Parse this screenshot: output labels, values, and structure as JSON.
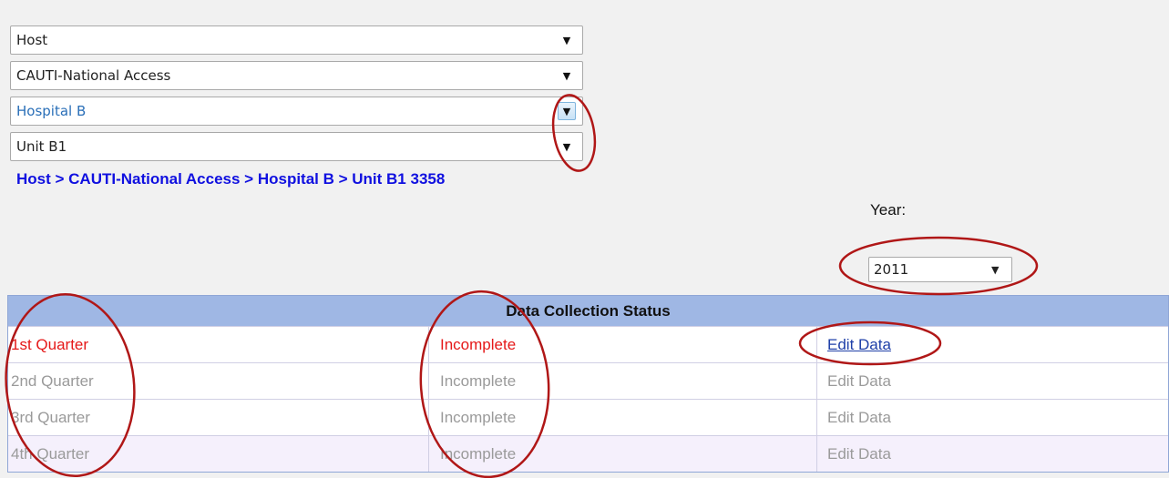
{
  "selects": [
    {
      "value": "Host"
    },
    {
      "value": "CAUTI-National Access"
    },
    {
      "value": "Hospital B"
    },
    {
      "value": "Unit B1"
    }
  ],
  "breadcrumb": "Host > CAUTI-National Access > Hospital B > Unit B1 3358",
  "year": {
    "label": "Year:",
    "value": "2011"
  },
  "table": {
    "title": "Data Collection Status",
    "rows": [
      {
        "quarter": "1st Quarter",
        "status": "Incomplete",
        "action": "Edit Data"
      },
      {
        "quarter": "2nd Quarter",
        "status": "Incomplete",
        "action": "Edit Data"
      },
      {
        "quarter": "3rd Quarter",
        "status": "Incomplete",
        "action": "Edit Data"
      },
      {
        "quarter": "4th Quarter",
        "status": "Incomplete",
        "action": "Edit Data"
      }
    ]
  },
  "icons": {
    "dropdown": "chevron-down-icon"
  },
  "colors": {
    "annotation": "#b01717",
    "active_row": "#e51818",
    "breadcrumb": "#1010e0",
    "header": "#9fb7e4"
  }
}
